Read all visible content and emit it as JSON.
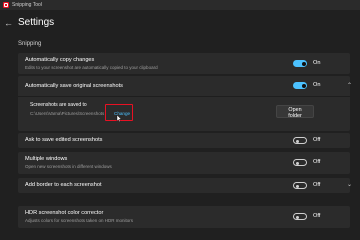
{
  "window": {
    "title": "Snipping Tool"
  },
  "header": {
    "back_glyph": "←",
    "title": "Settings"
  },
  "section": {
    "title": "Snipping"
  },
  "settings": [
    {
      "label": "Automatically copy changes",
      "description": "Edits to your screenshot are automatically copied to your clipboard",
      "state": "On",
      "enabled": true
    },
    {
      "label": "Automatically save original screenshots",
      "state": "On",
      "enabled": true,
      "expanded": true,
      "sub": {
        "label": "Screenshots are saved to",
        "path": "C:\\Users\\Varna\\Pictures\\Screenshots",
        "change_label": "Change",
        "button_label": "Open folder"
      }
    },
    {
      "label": "Ask to save edited screenshots",
      "state": "Off",
      "enabled": false
    },
    {
      "label": "Multiple windows",
      "description": "Open new screenshots in different windows",
      "state": "Off",
      "enabled": false
    },
    {
      "label": "Add border to each screenshot",
      "state": "Off",
      "enabled": false,
      "expandable": true
    },
    {
      "label": "HDR screenshot color corrector",
      "description": "Adjusts colors for screenshots taken on HDR monitors",
      "state": "Off",
      "enabled": false
    }
  ],
  "icons": {
    "app": "snipping-tool-icon",
    "back": "back-arrow-icon",
    "chevron_up": "chevron-up-icon",
    "chevron_down": "chevron-down-icon",
    "cursor": "mouse-cursor-icon"
  },
  "colors": {
    "accent": "#4cc2ff",
    "highlight": "#e81123",
    "background": "#202020",
    "card": "#2b2b2b"
  }
}
